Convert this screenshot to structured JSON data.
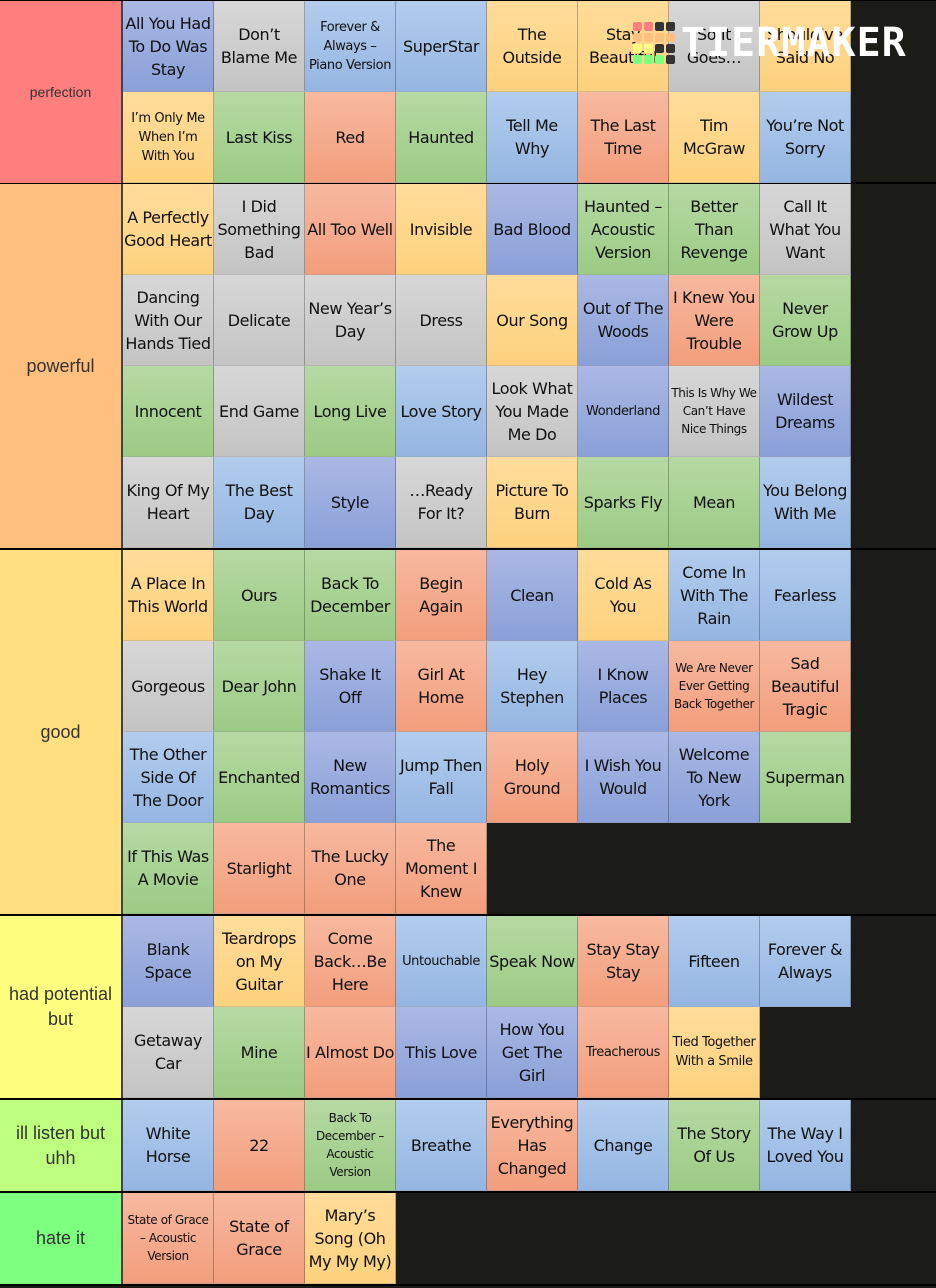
{
  "watermark": {
    "text": "TIERMAKER",
    "grid_colors": [
      "#ff7f7f",
      "#ff7f7f",
      "#333333",
      "#333333",
      "#ffbf7f",
      "#ffbf7f",
      "#ffbf7f",
      "#ffbf7f",
      "#ffff7f",
      "#ffff7f",
      "#333333",
      "#333333",
      "#7fff7f",
      "#7fff7f",
      "#7fff7f",
      "#333333"
    ]
  },
  "tiers": [
    {
      "label": "perfection",
      "color": "#ff7f7f",
      "items": [
        {
          "title": "All You Had To Do Was Stay",
          "color": "navy"
        },
        {
          "title": "Don’t Blame Me",
          "color": "grey"
        },
        {
          "title": "Forever & Always – Piano Version",
          "color": "blue",
          "size": "sm"
        },
        {
          "title": "SuperStar",
          "color": "blue"
        },
        {
          "title": "The Outside",
          "color": "yellow"
        },
        {
          "title": "Stay Beautiful",
          "color": "yellow"
        },
        {
          "title": "So It Goes…",
          "color": "grey"
        },
        {
          "title": "Should’ve Said No",
          "color": "yellow"
        },
        {
          "title": "I’m Only Me When I’m With You",
          "color": "yellow",
          "size": "sm"
        },
        {
          "title": "Last Kiss",
          "color": "green"
        },
        {
          "title": "Red",
          "color": "salmon"
        },
        {
          "title": "Haunted",
          "color": "green"
        },
        {
          "title": "Tell Me Why",
          "color": "blue"
        },
        {
          "title": "The Last Time",
          "color": "salmon"
        },
        {
          "title": "Tim McGraw",
          "color": "yellow"
        },
        {
          "title": "You’re Not Sorry",
          "color": "blue"
        }
      ]
    },
    {
      "label": "powerful",
      "color": "#ffbf7f",
      "items": [
        {
          "title": "A Perfectly Good Heart",
          "color": "yellow"
        },
        {
          "title": "I Did Something Bad",
          "color": "grey"
        },
        {
          "title": "All Too Well",
          "color": "salmon"
        },
        {
          "title": "Invisible",
          "color": "yellow"
        },
        {
          "title": "Bad Blood",
          "color": "navy"
        },
        {
          "title": "Haunted – Acoustic Version",
          "color": "green"
        },
        {
          "title": "Better Than Revenge",
          "color": "green"
        },
        {
          "title": "Call It What You Want",
          "color": "grey"
        },
        {
          "title": "Dancing With Our Hands Tied",
          "color": "grey"
        },
        {
          "title": "Delicate",
          "color": "grey"
        },
        {
          "title": "New Year’s Day",
          "color": "grey"
        },
        {
          "title": "Dress",
          "color": "grey"
        },
        {
          "title": "Our Song",
          "color": "yellow"
        },
        {
          "title": "Out of The Woods",
          "color": "navy"
        },
        {
          "title": "I Knew You Were Trouble",
          "color": "salmon"
        },
        {
          "title": "Never Grow Up",
          "color": "green"
        },
        {
          "title": "Innocent",
          "color": "green"
        },
        {
          "title": "End Game",
          "color": "grey"
        },
        {
          "title": "Long Live",
          "color": "green"
        },
        {
          "title": "Love Story",
          "color": "blue"
        },
        {
          "title": "Look What You Made Me Do",
          "color": "grey"
        },
        {
          "title": "Wonderland",
          "color": "navy",
          "size": "sm"
        },
        {
          "title": "This Is Why We Can’t Have Nice Things",
          "color": "grey",
          "size": "xs"
        },
        {
          "title": "Wildest Dreams",
          "color": "navy"
        },
        {
          "title": "King Of My Heart",
          "color": "grey"
        },
        {
          "title": "The Best Day",
          "color": "blue"
        },
        {
          "title": "Style",
          "color": "navy"
        },
        {
          "title": "…Ready For It?",
          "color": "grey"
        },
        {
          "title": "Picture To Burn",
          "color": "yellow"
        },
        {
          "title": "Sparks Fly",
          "color": "green"
        },
        {
          "title": "Mean",
          "color": "green"
        },
        {
          "title": "You Belong With Me",
          "color": "blue"
        }
      ]
    },
    {
      "label": "good",
      "color": "#ffdf7f",
      "items": [
        {
          "title": "A Place In This World",
          "color": "yellow"
        },
        {
          "title": "Ours",
          "color": "green"
        },
        {
          "title": "Back To December",
          "color": "green"
        },
        {
          "title": "Begin Again",
          "color": "salmon"
        },
        {
          "title": "Clean",
          "color": "navy"
        },
        {
          "title": "Cold As You",
          "color": "yellow"
        },
        {
          "title": "Come In With The Rain",
          "color": "blue"
        },
        {
          "title": "Fearless",
          "color": "blue"
        },
        {
          "title": "Gorgeous",
          "color": "grey"
        },
        {
          "title": "Dear John",
          "color": "green"
        },
        {
          "title": "Shake It Off",
          "color": "navy"
        },
        {
          "title": "Girl At Home",
          "color": "salmon"
        },
        {
          "title": "Hey Stephen",
          "color": "blue"
        },
        {
          "title": "I Know Places",
          "color": "navy"
        },
        {
          "title": "We Are Never Ever Getting Back Together",
          "color": "salmon",
          "size": "xs"
        },
        {
          "title": "Sad Beautiful Tragic",
          "color": "salmon"
        },
        {
          "title": "The Other Side Of The Door",
          "color": "blue"
        },
        {
          "title": "Enchanted",
          "color": "green"
        },
        {
          "title": "New Romantics",
          "color": "navy"
        },
        {
          "title": "Jump Then Fall",
          "color": "blue"
        },
        {
          "title": "Holy Ground",
          "color": "salmon"
        },
        {
          "title": "I Wish You Would",
          "color": "navy"
        },
        {
          "title": "Welcome To New York",
          "color": "navy"
        },
        {
          "title": "Superman",
          "color": "green"
        },
        {
          "title": "If This Was A Movie",
          "color": "green"
        },
        {
          "title": "Starlight",
          "color": "salmon"
        },
        {
          "title": "The Lucky One",
          "color": "salmon"
        },
        {
          "title": "The Moment I Knew",
          "color": "salmon"
        }
      ]
    },
    {
      "label": "had potential but",
      "color": "#ffff7f",
      "items": [
        {
          "title": "Blank Space",
          "color": "navy"
        },
        {
          "title": "Teardrops on My Guitar",
          "color": "yellow"
        },
        {
          "title": "Come Back…Be Here",
          "color": "salmon"
        },
        {
          "title": "Untouchable",
          "color": "blue",
          "size": "sm"
        },
        {
          "title": "Speak Now",
          "color": "green"
        },
        {
          "title": "Stay Stay Stay",
          "color": "salmon"
        },
        {
          "title": "Fifteen",
          "color": "blue"
        },
        {
          "title": "Forever & Always",
          "color": "blue"
        },
        {
          "title": "Getaway Car",
          "color": "grey"
        },
        {
          "title": "Mine",
          "color": "green"
        },
        {
          "title": "I Almost Do",
          "color": "salmon"
        },
        {
          "title": "This Love",
          "color": "navy"
        },
        {
          "title": "How You Get The Girl",
          "color": "navy"
        },
        {
          "title": "Treacherous",
          "color": "salmon",
          "size": "sm"
        },
        {
          "title": "Tied Together With a Smile",
          "color": "yellow",
          "size": "sm"
        }
      ]
    },
    {
      "label": "ill listen but uhh",
      "color": "#bfff7f",
      "items": [
        {
          "title": "White Horse",
          "color": "blue"
        },
        {
          "title": "22",
          "color": "salmon"
        },
        {
          "title": "Back To December – Acoustic Version",
          "color": "green",
          "size": "xs"
        },
        {
          "title": "Breathe",
          "color": "blue"
        },
        {
          "title": "Everything Has Changed",
          "color": "salmon"
        },
        {
          "title": "Change",
          "color": "blue"
        },
        {
          "title": "The Story Of Us",
          "color": "green"
        },
        {
          "title": "The Way I Loved You",
          "color": "blue"
        }
      ]
    },
    {
      "label": "hate it",
      "color": "#7fff7f",
      "items": [
        {
          "title": "State of Grace – Acoustic Version",
          "color": "salmon",
          "size": "xs"
        },
        {
          "title": "State of Grace",
          "color": "salmon"
        },
        {
          "title": "Mary’s Song (Oh My My My)",
          "color": "yellow"
        }
      ]
    }
  ]
}
